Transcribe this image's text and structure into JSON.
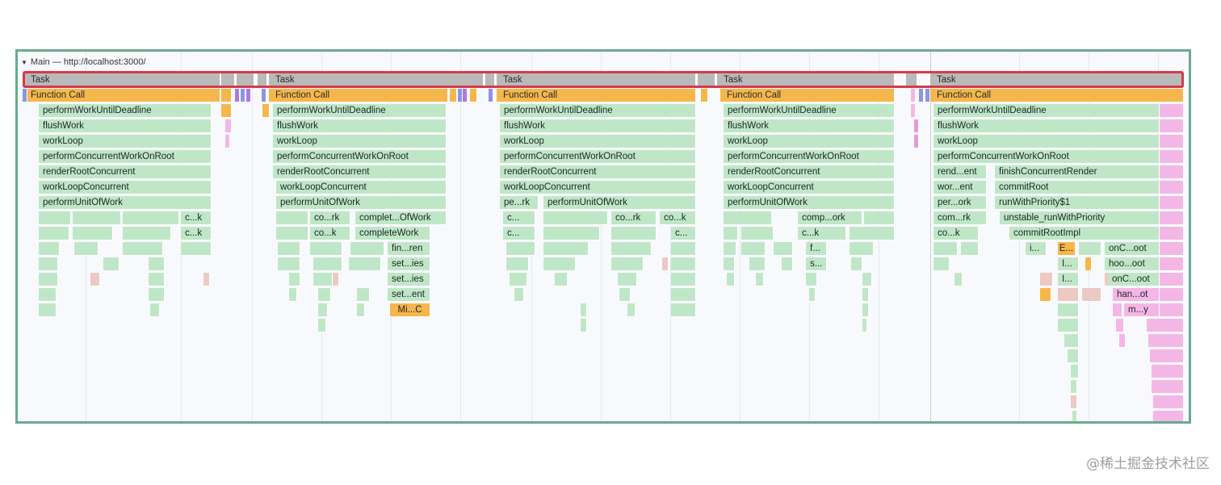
{
  "track": {
    "collapse_glyph": "▼",
    "title": "Main — http://localhost:3000/"
  },
  "tasks": [
    {
      "task_label": "Task",
      "call_label": "Function Call",
      "stack": [
        "performWorkUntilDeadline",
        "flushWork",
        "workLoop",
        "performConcurrentWorkOnRoot",
        "renderRootConcurrent",
        "workLoopConcurrent",
        "performUnitOfWork"
      ],
      "deep": [
        {
          "label": "c...k"
        },
        {
          "label": "c...k"
        }
      ]
    },
    {
      "task_label": "Task",
      "call_label": "Function Call",
      "stack": [
        "performWorkUntilDeadline",
        "flushWork",
        "workLoop",
        "performConcurrentWorkOnRoot",
        "renderRootConcurrent",
        "workLoopConcurrent",
        "performUnitOfWork"
      ],
      "deep": [
        {
          "label": "co...rk"
        },
        {
          "label": "complet...OfWork"
        },
        {
          "label": "co...k"
        },
        {
          "label": "completeWork"
        },
        {
          "label": "fin...ren"
        },
        {
          "label": "set...ies"
        },
        {
          "label": "set...ies"
        },
        {
          "label": "set...ent"
        },
        {
          "label": "Mi...C"
        }
      ]
    },
    {
      "task_label": "Task",
      "call_label": "Function Call",
      "stack": [
        "performWorkUntilDeadline",
        "flushWork",
        "workLoop",
        "performConcurrentWorkOnRoot",
        "renderRootConcurrent",
        "workLoopConcurrent"
      ],
      "deep": [
        {
          "label": "pe...rk"
        },
        {
          "label": "performUnitOfWork"
        },
        {
          "label": "c..."
        },
        {
          "label": "co...rk"
        },
        {
          "label": "co...k"
        },
        {
          "label": "c..."
        },
        {
          "label": "c..."
        }
      ]
    },
    {
      "task_label": "Task",
      "call_label": "Function Call",
      "stack": [
        "performWorkUntilDeadline",
        "flushWork",
        "workLoop",
        "performConcurrentWorkOnRoot",
        "renderRootConcurrent",
        "workLoopConcurrent",
        "performUnitOfWork"
      ],
      "deep": [
        {
          "label": "comp...ork"
        },
        {
          "label": "c...k"
        },
        {
          "label": "f..."
        },
        {
          "label": "s..."
        }
      ]
    },
    {
      "task_label": "Task",
      "call_label": "Function Call",
      "stack": [
        "performWorkUntilDeadline",
        "flushWork",
        "workLoop",
        "performConcurrentWorkOnRoot"
      ],
      "deep": [
        {
          "label": "rend...ent"
        },
        {
          "label": "finishConcurrentRender"
        },
        {
          "label": "wor...ent"
        },
        {
          "label": "commitRoot"
        },
        {
          "label": "per...ork"
        },
        {
          "label": "runWithPriority$1"
        },
        {
          "label": "com...rk"
        },
        {
          "label": "unstable_runWithPriority"
        },
        {
          "label": "co...k"
        },
        {
          "label": "commitRootImpl"
        },
        {
          "label": "i..."
        },
        {
          "label": "E..."
        },
        {
          "label": "onC...oot"
        },
        {
          "label": "I..."
        },
        {
          "label": "hoo...oot"
        },
        {
          "label": "I..."
        },
        {
          "label": "onC...oot"
        },
        {
          "label": "han...ot"
        },
        {
          "label": "m...y"
        }
      ]
    }
  ],
  "watermark": "@稀土掘金技术社区",
  "colors": {
    "frame_border": "#6aaa8e",
    "selection_border": "#d63a4a",
    "task": "#b9b9b9",
    "function_call": "#f5b74b",
    "js_frame": "#bfe7c7",
    "paint": "#f3b7e6"
  }
}
